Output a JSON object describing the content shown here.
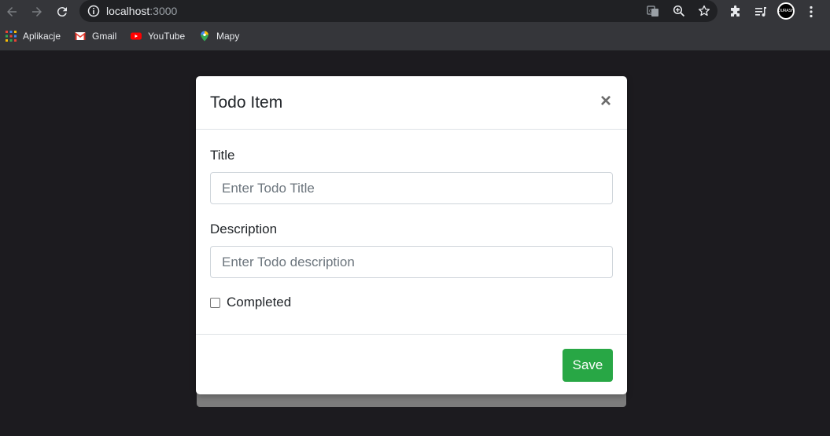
{
  "browser": {
    "url_host": "localhost",
    "url_port": ":3000",
    "profile_label": "DURASH"
  },
  "bookmarks": [
    {
      "label": "Aplikacje",
      "icon": "apps-grid-icon"
    },
    {
      "label": "Gmail",
      "icon": "gmail-icon"
    },
    {
      "label": "YouTube",
      "icon": "youtube-icon"
    },
    {
      "label": "Mapy",
      "icon": "maps-pin-icon"
    }
  ],
  "modal": {
    "title": "Todo Item",
    "close_symbol": "×",
    "fields": {
      "title_label": "Title",
      "title_placeholder": "Enter Todo Title",
      "description_label": "Description",
      "description_placeholder": "Enter Todo description",
      "completed_label": "Completed",
      "completed_checked": false
    },
    "save_label": "Save"
  },
  "colors": {
    "save_button": "#28a745",
    "page_background": "#1c1b1f",
    "chrome_background": "#35363a"
  }
}
